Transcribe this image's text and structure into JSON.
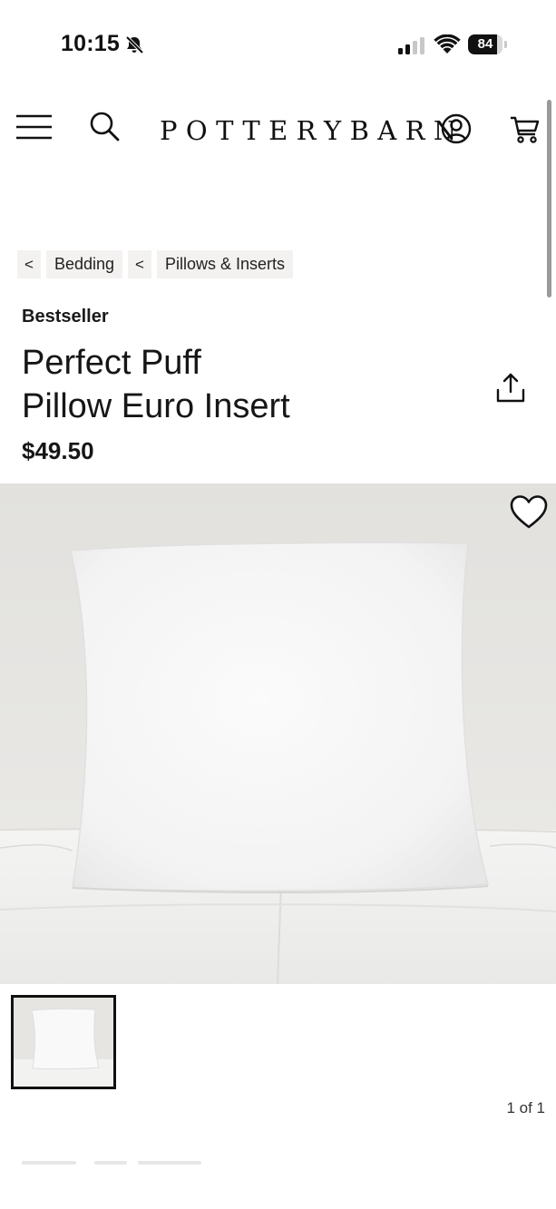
{
  "status_bar": {
    "time": "10:15",
    "battery_level": "84",
    "battery_fraction": 0.84
  },
  "header": {
    "brand": "POTTERYBARN"
  },
  "breadcrumb": {
    "back_symbol": "<",
    "items": [
      "Bedding",
      "Pillows & Inserts"
    ]
  },
  "product": {
    "badge": "Bestseller",
    "title_line1": "Perfect Puff",
    "title_line2": "Pillow Euro Insert",
    "price": "$49.50"
  },
  "gallery": {
    "counter": "1 of 1"
  },
  "icons": {
    "status": [
      "bell-off-icon",
      "signal-icon",
      "wifi-icon",
      "battery-icon"
    ],
    "header": [
      "menu-icon",
      "search-icon",
      "account-icon",
      "cart-icon"
    ],
    "product": [
      "share-icon",
      "heart-icon"
    ]
  },
  "colors": {
    "text": "#111111",
    "chip_background": "#f3f2f0",
    "image_background": "#e4e3e0"
  }
}
